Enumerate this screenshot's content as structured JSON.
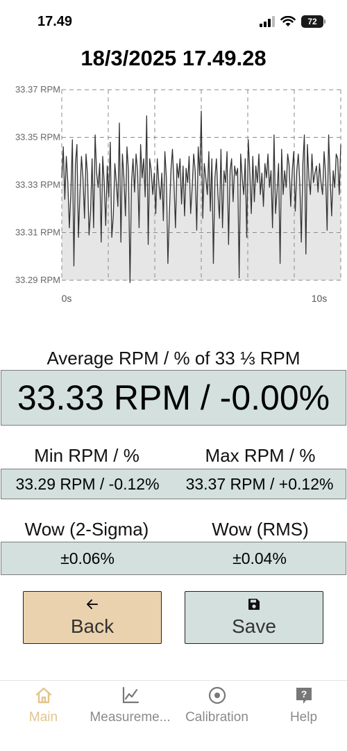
{
  "status_bar": {
    "time": "17.49",
    "battery": "72"
  },
  "title": "18/3/2025 17.49.28",
  "chart_data": {
    "type": "area",
    "title": "",
    "xlabel": "",
    "ylabel": "",
    "x_tick_labels": [
      "0s",
      "10s"
    ],
    "y_tick_labels": [
      "33.37 RPM",
      "33.35 RPM",
      "33.33 RPM",
      "33.31 RPM",
      "33.29 RPM"
    ],
    "y_ticks": [
      33.37,
      33.35,
      33.33,
      33.31,
      33.29
    ],
    "xlim": [
      0,
      10
    ],
    "ylim": [
      33.29,
      33.37
    ],
    "grid": true,
    "fill_color": "#e6e6e6",
    "line_color": "#333333",
    "series": [
      {
        "values": [
          33.333,
          33.346,
          33.324,
          33.342,
          33.331,
          33.312,
          33.327,
          33.349,
          33.296,
          33.339,
          33.347,
          33.308,
          33.327,
          33.342,
          33.333,
          33.316,
          33.343,
          33.334,
          33.309,
          33.319,
          33.341,
          33.312,
          33.351,
          33.335,
          33.329,
          33.339,
          33.306,
          33.342,
          33.331,
          33.313,
          33.338,
          33.325,
          33.348,
          33.308,
          33.317,
          33.339,
          33.331,
          33.321,
          33.356,
          33.306,
          33.343,
          33.333,
          33.317,
          33.346,
          33.336,
          33.289,
          33.331,
          33.341,
          33.327,
          33.343,
          33.336,
          33.312,
          33.347,
          33.333,
          33.341,
          33.325,
          33.359,
          33.305,
          33.341,
          33.336,
          33.326,
          33.335,
          33.318,
          33.341,
          33.331,
          33.324,
          33.335,
          33.315,
          33.344,
          33.333,
          33.297,
          33.319,
          33.336,
          33.345,
          33.331,
          33.312,
          33.339,
          33.333,
          33.341,
          33.322,
          33.338,
          33.317,
          33.337,
          33.331,
          33.342,
          33.318,
          33.329,
          33.343,
          33.336,
          33.311,
          33.346,
          33.334,
          33.361,
          33.316,
          33.339,
          33.333,
          33.326,
          33.344,
          33.319,
          33.341,
          33.297,
          33.333,
          33.341,
          33.326,
          33.316,
          33.345,
          33.312,
          33.336,
          33.331,
          33.344,
          33.305,
          33.336,
          33.341,
          33.323,
          33.338,
          33.334,
          33.337,
          33.291,
          33.343,
          33.333,
          33.326,
          33.341,
          33.308,
          33.349,
          33.336,
          33.318,
          33.342,
          33.323,
          33.338,
          33.331,
          33.343,
          33.326,
          33.335,
          33.321,
          33.339,
          33.333,
          33.343,
          33.329,
          33.336,
          33.312,
          33.351,
          33.318,
          33.328,
          33.339,
          33.297,
          33.345,
          33.326,
          33.336,
          33.329,
          33.343,
          33.338,
          33.321,
          33.336,
          33.344,
          33.319,
          33.336,
          33.343,
          33.331,
          33.306,
          33.339,
          33.351,
          33.301,
          33.347,
          33.333,
          33.326,
          33.343,
          33.331,
          33.335,
          33.338,
          33.327,
          33.339,
          33.331,
          33.326,
          33.344,
          33.335,
          33.311,
          33.351,
          33.333,
          33.317,
          33.336,
          33.329,
          33.343,
          33.341,
          33.326,
          33.347
        ]
      }
    ]
  },
  "average": {
    "label": "Average RPM / % of 33 ⅓ RPM",
    "value": "33.33 RPM / -0.00%"
  },
  "min": {
    "label": "Min RPM / %",
    "value": "33.29 RPM / -0.12%"
  },
  "max": {
    "label": "Max RPM / %",
    "value": "33.37 RPM / +0.12%"
  },
  "wow_2sigma": {
    "label": "Wow (2-Sigma)",
    "value": "±0.06%"
  },
  "wow_rms": {
    "label": "Wow (RMS)",
    "value": "±0.04%"
  },
  "buttons": {
    "back": {
      "label": "Back",
      "icon": "arrow-left-icon"
    },
    "save": {
      "label": "Save",
      "icon": "floppy-disk-icon"
    }
  },
  "tabs": [
    {
      "label": "Main",
      "icon": "home-icon",
      "active": true
    },
    {
      "label": "Measureme...",
      "icon": "line-chart-icon",
      "active": false
    },
    {
      "label": "Calibration",
      "icon": "target-icon",
      "active": false
    },
    {
      "label": "Help",
      "icon": "help-icon",
      "active": false
    }
  ],
  "colors": {
    "accent_active_tab": "#e2c48e",
    "value_box_bg": "#d3e0de",
    "back_button_bg": "#ebd2ae"
  }
}
